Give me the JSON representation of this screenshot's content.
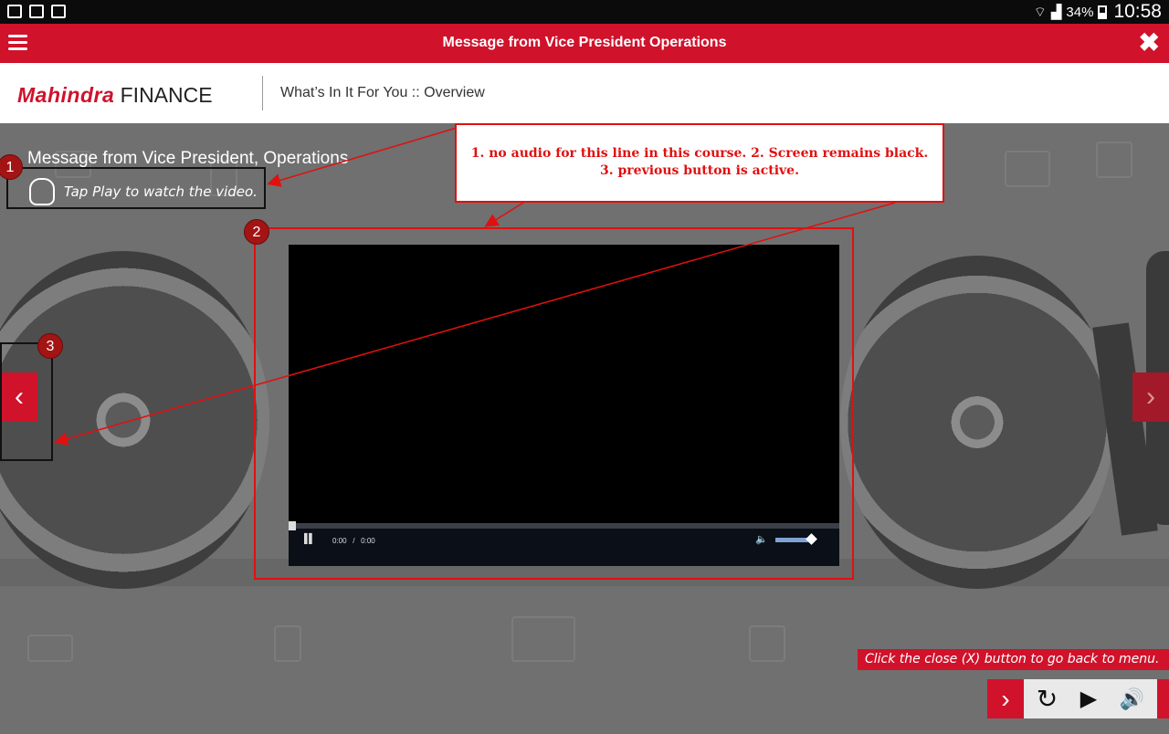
{
  "status_bar": {
    "battery": "34%",
    "time": "10:58"
  },
  "title_bar": {
    "title": "Message from Vice President Operations"
  },
  "header": {
    "logo_brand": "Mahindra",
    "logo_finance": "FINANCE",
    "subtitle": "What’s In It For You :: Overview"
  },
  "content": {
    "page_title": "Message from Vice President, Operations",
    "tap_hint": "Tap Play to watch the video."
  },
  "video": {
    "current_time": "0:00",
    "separator": "/",
    "duration": "0:00",
    "progress": 0,
    "volume": 1.0
  },
  "instruction": "Click the close (X) button to go back to menu.",
  "annotations": {
    "callout_text": "1. no audio for this line in this course. 2. Screen remains black.  3. previous button is active.",
    "markers": [
      "1",
      "2",
      "3"
    ]
  },
  "colors": {
    "brand_red": "#d0122b",
    "annotation_red": "#e01010",
    "marker_red": "#a31414"
  }
}
